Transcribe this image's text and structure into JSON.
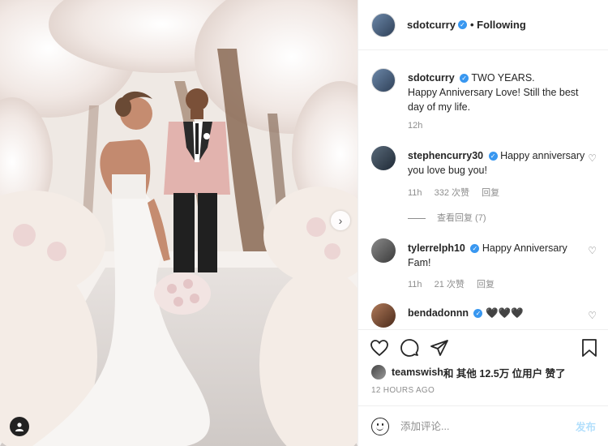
{
  "post": {
    "author": "sdotcurry",
    "follow_label": "• Following",
    "verified_glyph": "✓"
  },
  "caption": {
    "user": "sdotcurry",
    "text": "TWO YEARS.\nHappy Anniversary Love! Still the best day of my life.",
    "time": "12h"
  },
  "comments": [
    {
      "user": "stephencurry30",
      "text": "Happy anniversary you love bug you!",
      "time": "11h",
      "likes": "332 次赞",
      "reply": "回复",
      "view_replies": "查看回复 (7)"
    },
    {
      "user": "tylerrelph10",
      "text": "Happy Anniversary Fam!",
      "time": "11h",
      "likes": "21 次赞",
      "reply": "回复"
    },
    {
      "user": "bendadonnn",
      "text": "🖤🖤🖤"
    }
  ],
  "likes_text": {
    "user": "teamswish",
    "rest": " 和 其他 12.5万 位用户 赞了"
  },
  "timestamp": "12 HOURS AGO",
  "comment_input": {
    "placeholder": "添加评论...",
    "post_label": "发布"
  },
  "icons": {
    "heart": "heart-icon",
    "comment": "comment-icon",
    "share": "share-icon",
    "save": "bookmark-icon",
    "next": "chevron-right-icon",
    "tag": "user-tag-icon",
    "emoji": "emoji-icon"
  },
  "colors": {
    "verified": "#3897f0",
    "post_disabled": "#b2dffc",
    "meta": "#8e8e8e"
  }
}
